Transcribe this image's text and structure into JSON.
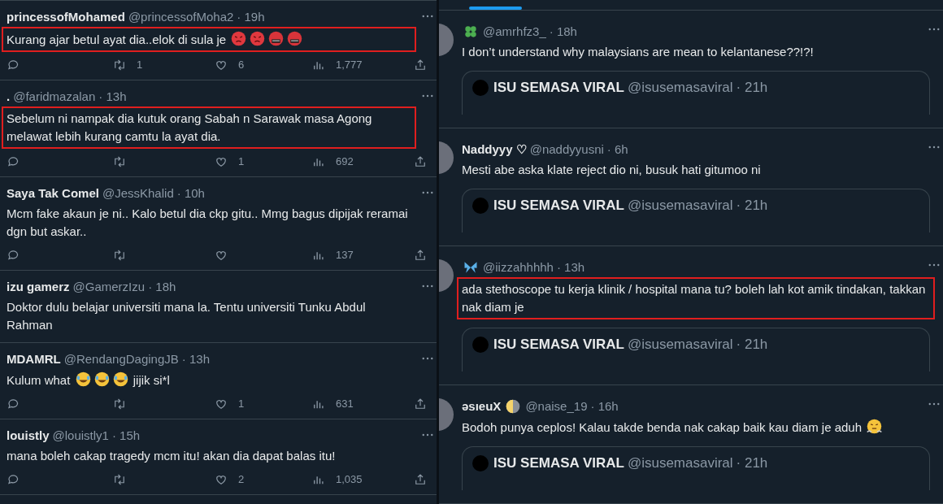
{
  "left_tweets": [
    {
      "name": "princessofMohamed",
      "handle": "@princessofMoha2",
      "time": "· 19h",
      "text": "Kurang ajar betul ayat dia..elok di sula je",
      "emojis": [
        {
          "kind": "angry"
        },
        {
          "kind": "angry"
        },
        {
          "kind": "cursing"
        },
        {
          "kind": "cursing"
        }
      ],
      "highlighted": true,
      "actions": {
        "retweets": "1",
        "likes": "6",
        "views": "1,777"
      }
    },
    {
      "name": ".",
      "handle": "@faridmazalan",
      "time": "· 13h",
      "text": "Sebelum ni nampak dia kutuk orang Sabah n Sarawak masa Agong melawat lebih kurang camtu la ayat dia.",
      "highlighted": true,
      "actions": {
        "likes": "1",
        "views": "692"
      }
    },
    {
      "name": "Saya Tak Comel",
      "handle": "@JessKhalid",
      "time": "· 10h",
      "text": "Mcm fake akaun je ni.. Kalo betul dia ckp gitu.. Mmg bagus dipijak reramai dgn but askar..",
      "highlighted": false,
      "actions": {
        "views": "137"
      }
    },
    {
      "name": "izu gamerz",
      "handle": "@GamerzIzu",
      "time": "· 18h",
      "text": "Doktor dulu belajar universiti mana la. Tentu universiti Tunku Abdul Rahman",
      "highlighted": false
    },
    {
      "name": "MDAMRL",
      "handle": "@RendangDagingJB",
      "time": "· 13h",
      "text": "Kulum what",
      "emojis": [
        {
          "kind": "laughing"
        },
        {
          "kind": "laughing"
        },
        {
          "kind": "laughing"
        }
      ],
      "text_after": "jijik si*l",
      "highlighted": false,
      "actions": {
        "likes": "1",
        "views": "631"
      }
    },
    {
      "name": "louistly",
      "handle": "@louistly1",
      "time": "· 15h",
      "text": "mana boleh cakap tragedy mcm itu! akan dia dapat balas itu!",
      "highlighted": false,
      "actions": {
        "likes": "2",
        "views": "1,035"
      }
    }
  ],
  "right_tweets": [
    {
      "name_emoji": {
        "kind": "clover"
      },
      "handle": "@amrhfz3_",
      "time": "· 18h",
      "text": "I don’t understand why malaysians are mean to kelantanese??!?!",
      "highlighted": false,
      "quote": {
        "name": "ISU SEMASA VIRAL",
        "handle": "@isusemasaviral",
        "time": "· 21h"
      }
    },
    {
      "name": "Naddyyy ♡",
      "handle": "@naddyyusni",
      "time": "· 6h",
      "text": "Mesti abe aska klate reject dio ni, busuk hati gitumoo ni",
      "highlighted": false,
      "quote": {
        "name": "ISU SEMASA VIRAL",
        "handle": "@isusemasaviral",
        "time": "· 21h"
      }
    },
    {
      "name_emoji": {
        "kind": "butterfly"
      },
      "handle": "@iizzahhhhh",
      "time": "· 13h",
      "text": "ada stethoscope tu kerja klinik / hospital mana tu? boleh lah kot amik tindakan, takkan nak diam je",
      "highlighted": true,
      "quote": {
        "name": "ISU SEMASA VIRAL",
        "handle": "@isusemasaviral",
        "time": "· 21h"
      }
    },
    {
      "name": "əsıeuX",
      "name_emoji": {
        "kind": "half-moon"
      },
      "handle": "@naise_19",
      "time": "· 16h",
      "text": "Bodoh punya ceplos! Kalau takde benda nak cakap baik kau diam je aduh",
      "emojis": [
        {
          "kind": "steaming"
        }
      ],
      "highlighted": false,
      "quote": {
        "name": "ISU SEMASA VIRAL",
        "handle": "@isusemasaviral",
        "time": "· 21h"
      }
    }
  ]
}
